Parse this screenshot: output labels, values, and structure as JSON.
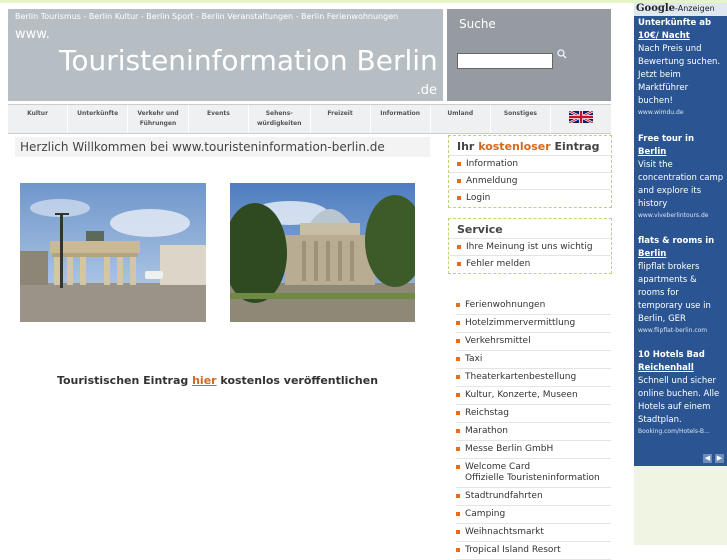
{
  "header": {
    "crumbs": "Berlin Tourismus - Berlin Kultur - Berlin Sport - Berlin Veranstaltungen - Berlin Ferienwohnungen",
    "www": "www.",
    "title": "Touristeninformation Berlin",
    "tld": ".de"
  },
  "search": {
    "label": "Suche",
    "placeholder": "",
    "icon": "search-icon"
  },
  "nav": {
    "items": [
      {
        "label": "Kultur"
      },
      {
        "label": "Unterkünfte"
      },
      {
        "label": "Verkehr und Führungen"
      },
      {
        "label": "Events"
      },
      {
        "label": "Sehens-würdigkeiten"
      },
      {
        "label": "Freizeit"
      },
      {
        "label": "Information"
      },
      {
        "label": "Umland"
      },
      {
        "label": "Sonstiges"
      }
    ],
    "flag_icon": "uk-flag-icon"
  },
  "welcome": "Herzlich Willkommen bei www.touristeninformation-berlin.de",
  "cta": {
    "prefix": "Touristischen Eintrag ",
    "link": "hier",
    "suffix": " kostenlos veröffentlichen"
  },
  "panel_entry": {
    "title_pre": "Ihr ",
    "title_hl": "kostenloser",
    "title_post": " Eintrag",
    "items": [
      "Information",
      "Anmeldung",
      "Login"
    ]
  },
  "panel_service": {
    "title": "Service",
    "items": [
      "Ihre Meinung ist uns wichtig",
      "Fehler melden"
    ]
  },
  "links": [
    "Ferienwohnungen",
    "Hotelzimmervermittlung",
    "Verkehrsmittel",
    "Taxi",
    "Theaterkartenbestellung",
    "Kultur, Konzerte, Museen",
    "Reichstag",
    "Marathon",
    "Messe Berlin GmbH",
    "Welcome Card\nOffizielle Touristeninformation",
    "Stadtrundfahrten",
    "Camping",
    "Weihnachtsmarkt",
    "Tropical Island Resort"
  ],
  "ads": {
    "logo": "Google",
    "logo_suffix": "-Anzeigen",
    "items": [
      {
        "t1": "Unterkünfte ab ",
        "t2": "10€/ Nacht",
        "desc": "Nach Preis und Bewertung suchen. Jetzt beim Marktführer buchen!",
        "url": "www.wimdu.de"
      },
      {
        "t1": "Free tour in ",
        "t2": "Berlin",
        "desc": "Visit the concentration camp and explore its history",
        "url": "www.viveberlintours.de"
      },
      {
        "t1": "flats & rooms in ",
        "t2": "Berlin",
        "desc": "flipflat brokers apartments & rooms for temporary use in Berlin, GER",
        "url": "www.flipflat-berlin.com"
      },
      {
        "t1": "10 Hotels Bad ",
        "t2": "Reichenhall",
        "desc": "Schnell und sicher online buchen. Alle Hotels auf einem Stadtplan.",
        "url": "Booking.com/Hotels-B..."
      }
    ]
  },
  "colors": {
    "accent": "#d2691e",
    "ad_bg": "#2b5592",
    "header_bg": "#b6bec4"
  }
}
